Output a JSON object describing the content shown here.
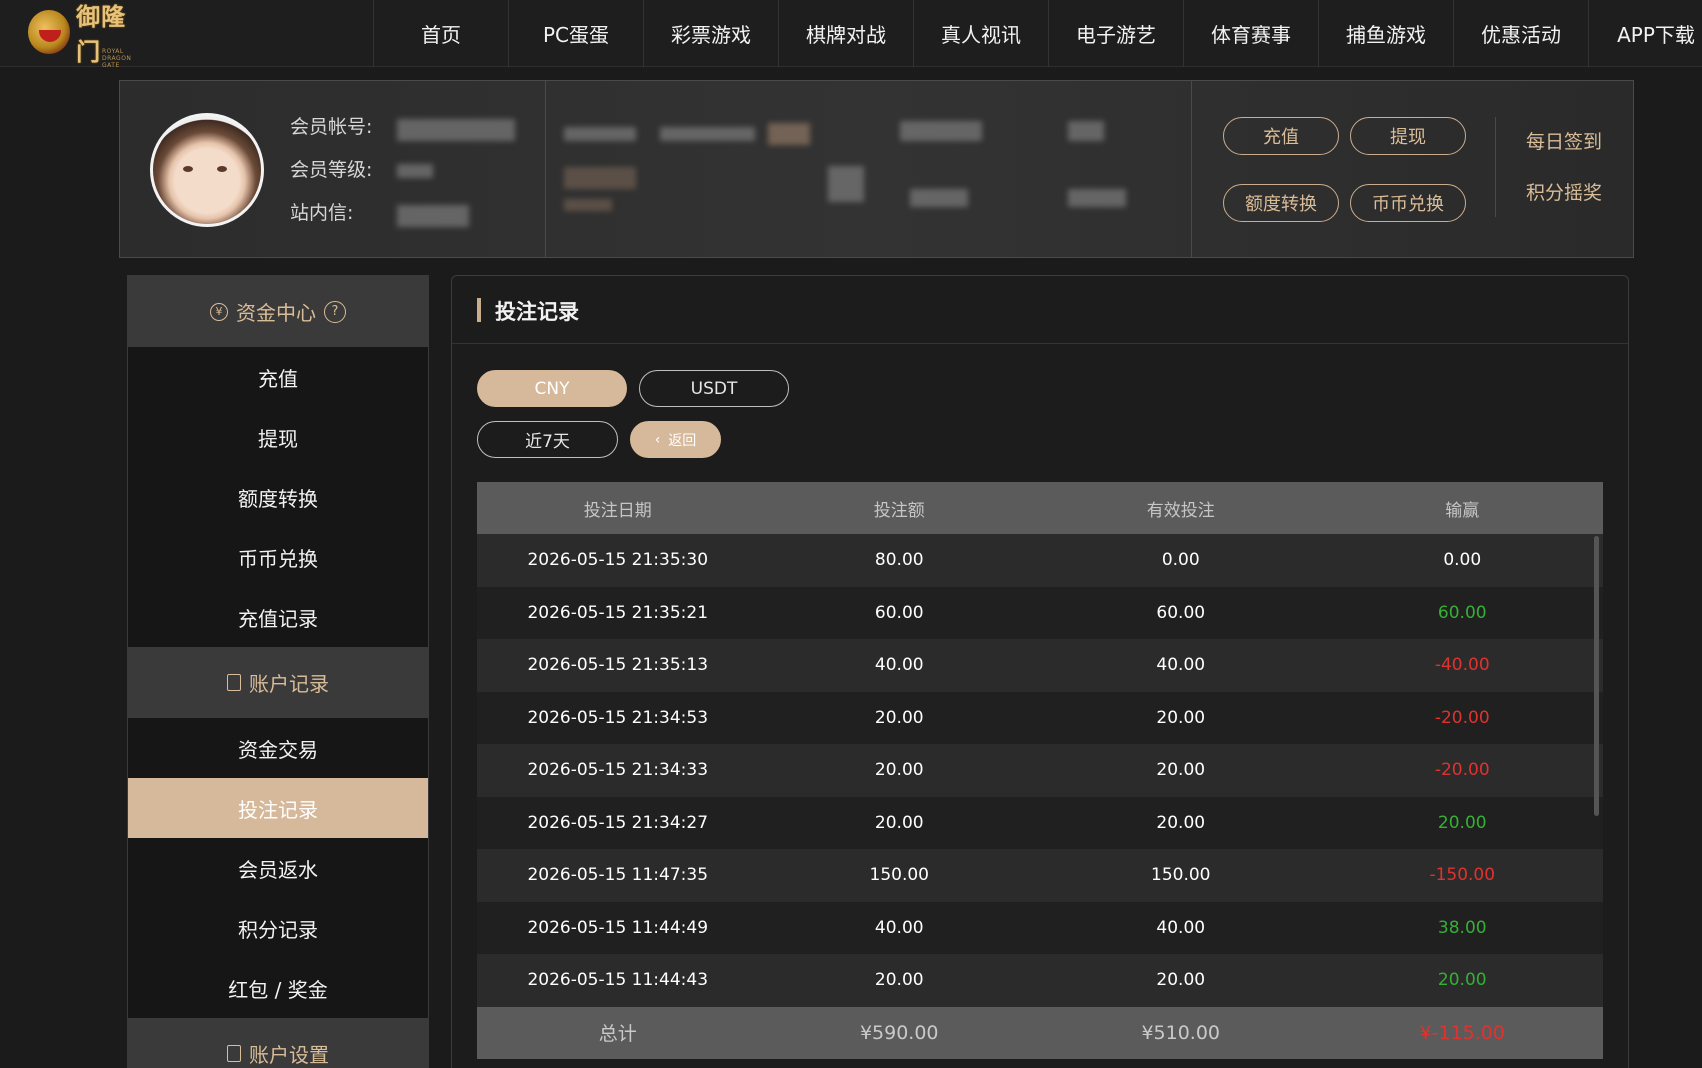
{
  "brand": {
    "name": "御隆门",
    "subtitle": "ROYAL DRAGON GATE"
  },
  "nav": [
    "首页",
    "PC蛋蛋",
    "彩票游戏",
    "棋牌对战",
    "真人视讯",
    "电子游艺",
    "体育赛事",
    "捕鱼游戏",
    "优惠活动",
    "APP下载"
  ],
  "profile": {
    "labels": {
      "account": "会员帐号:",
      "level": "会员等级:",
      "mail": "站内信:"
    },
    "buttons": {
      "deposit": "充值",
      "withdraw": "提现",
      "transfer": "额度转换",
      "exchange": "币币兑换"
    },
    "links": {
      "signin": "每日签到",
      "lottery": "积分摇奖"
    }
  },
  "sidebar": {
    "funds_header": "资金中心",
    "funds_items": [
      "充值",
      "提现",
      "额度转换",
      "币币兑换",
      "充值记录"
    ],
    "records_header": "账户记录",
    "records_items": [
      "资金交易",
      "投注记录",
      "会员返水",
      "积分记录",
      "红包 / 奖金"
    ],
    "active_item": "投注记录",
    "settings_header": "账户设置"
  },
  "main": {
    "title": "投注记录",
    "currency_tabs": [
      {
        "label": "CNY",
        "selected": true
      },
      {
        "label": "USDT",
        "selected": false
      }
    ],
    "period_label": "近7天",
    "back_label": "返回"
  },
  "table": {
    "headers": [
      "投注日期",
      "投注额",
      "有效投注",
      "输赢"
    ],
    "rows": [
      {
        "date": "2026-05-15 21:35:30",
        "bet": "80.00",
        "valid": "0.00",
        "result": "0.00",
        "sign": "zero"
      },
      {
        "date": "2026-05-15 21:35:21",
        "bet": "60.00",
        "valid": "60.00",
        "result": "60.00",
        "sign": "pos"
      },
      {
        "date": "2026-05-15 21:35:13",
        "bet": "40.00",
        "valid": "40.00",
        "result": "-40.00",
        "sign": "neg"
      },
      {
        "date": "2026-05-15 21:34:53",
        "bet": "20.00",
        "valid": "20.00",
        "result": "-20.00",
        "sign": "neg"
      },
      {
        "date": "2026-05-15 21:34:33",
        "bet": "20.00",
        "valid": "20.00",
        "result": "-20.00",
        "sign": "neg"
      },
      {
        "date": "2026-05-15 21:34:27",
        "bet": "20.00",
        "valid": "20.00",
        "result": "20.00",
        "sign": "pos"
      },
      {
        "date": "2026-05-15 11:47:35",
        "bet": "150.00",
        "valid": "150.00",
        "result": "-150.00",
        "sign": "neg"
      },
      {
        "date": "2026-05-15 11:44:49",
        "bet": "40.00",
        "valid": "40.00",
        "result": "38.00",
        "sign": "pos"
      },
      {
        "date": "2026-05-15 11:44:43",
        "bet": "20.00",
        "valid": "20.00",
        "result": "20.00",
        "sign": "pos"
      }
    ],
    "total": {
      "label": "总计",
      "bet": "¥590.00",
      "valid": "¥510.00",
      "result": "¥-115.00"
    }
  },
  "colors": {
    "accent": "#d6b89a",
    "positive": "#35b035",
    "negative": "#e0322e"
  }
}
